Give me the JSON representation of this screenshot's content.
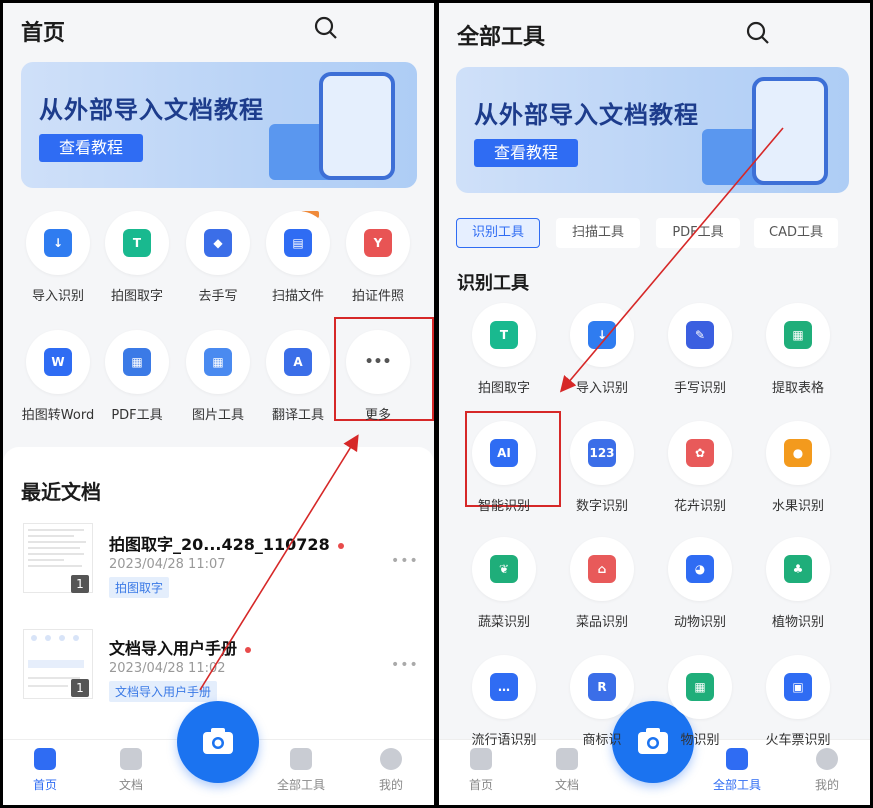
{
  "left": {
    "title": "首页",
    "banner": {
      "text": "从外部导入文档教程",
      "button": "查看教程"
    },
    "tools_row1": [
      {
        "label": "导入识别",
        "icon": "import-icon",
        "color": "#2f7cf0",
        "glyph": "↓"
      },
      {
        "label": "拍图取字",
        "icon": "text-capture-icon",
        "color": "#19b98f",
        "glyph": "T"
      },
      {
        "label": "去手写",
        "icon": "eraser-icon",
        "color": "#3b6ee8",
        "glyph": "◆"
      },
      {
        "label": "扫描文件",
        "icon": "scanner-icon",
        "color": "#2f6cf3",
        "glyph": "▤"
      },
      {
        "label": "拍证件照",
        "icon": "id-photo-icon",
        "color": "#e85454",
        "glyph": "Y"
      }
    ],
    "tools_row2": [
      {
        "label": "拍图转Word",
        "icon": "word-icon",
        "color": "#2f6cf3",
        "glyph": "W"
      },
      {
        "label": "PDF工具",
        "icon": "pdf-tools-icon",
        "color": "#3b7ae6",
        "glyph": "▦"
      },
      {
        "label": "图片工具",
        "icon": "image-tools-icon",
        "color": "#4a8af0",
        "glyph": "▦"
      },
      {
        "label": "翻译工具",
        "icon": "translate-icon",
        "color": "#3b6ee8",
        "glyph": "A"
      },
      {
        "label": "更多",
        "icon": "more-icon",
        "color": "#ffffff",
        "glyph": "•••"
      }
    ],
    "recent_title": "最近文档",
    "docs": [
      {
        "name": "拍图取字_20...428_110728",
        "date": "2023/04/28 11:07",
        "tag": "拍图取字",
        "pages": "1"
      },
      {
        "name": "文档导入用户手册",
        "date": "2023/04/28 11:02",
        "tag": "文档导入用户手册",
        "pages": "1"
      }
    ],
    "tabs": [
      {
        "label": "首页",
        "icon": "home-icon",
        "active": true
      },
      {
        "label": "文档",
        "icon": "document-icon",
        "active": false
      },
      {
        "label": "全部工具",
        "icon": "all-tools-icon",
        "active": false
      },
      {
        "label": "我的",
        "icon": "profile-icon",
        "active": false
      }
    ]
  },
  "right": {
    "title": "全部工具",
    "banner": {
      "text": "从外部导入文档教程",
      "button": "查看教程"
    },
    "chips": [
      {
        "label": "识别工具",
        "active": true
      },
      {
        "label": "扫描工具",
        "active": false
      },
      {
        "label": "PDF工具",
        "active": false
      },
      {
        "label": "CAD工具",
        "active": false
      }
    ],
    "section": "识别工具",
    "grid": [
      {
        "label": "拍图取字",
        "icon": "text-capture-icon",
        "color": "#19b98f",
        "glyph": "T"
      },
      {
        "label": "导入识别",
        "icon": "import-icon",
        "color": "#2f7cf0",
        "glyph": "↓"
      },
      {
        "label": "手写识别",
        "icon": "handwriting-icon",
        "color": "#3b5fe0",
        "glyph": "✎"
      },
      {
        "label": "提取表格",
        "icon": "table-icon",
        "color": "#1fae7a",
        "glyph": "▦"
      },
      {
        "label": "智能识别",
        "icon": "ai-icon",
        "color": "#2f6cf3",
        "glyph": "AI"
      },
      {
        "label": "数字识别",
        "icon": "number-icon",
        "color": "#3b6ee8",
        "glyph": "123"
      },
      {
        "label": "花卉识别",
        "icon": "flower-icon",
        "color": "#e85a5a",
        "glyph": "✿"
      },
      {
        "label": "水果识别",
        "icon": "fruit-icon",
        "color": "#f39a1d",
        "glyph": "●"
      },
      {
        "label": "蔬菜识别",
        "icon": "vegetable-icon",
        "color": "#1fae7a",
        "glyph": "❦"
      },
      {
        "label": "菜品识别",
        "icon": "dish-icon",
        "color": "#e85a5a",
        "glyph": "⌂"
      },
      {
        "label": "动物识别",
        "icon": "animal-icon",
        "color": "#2f6cf3",
        "glyph": "◕"
      },
      {
        "label": "植物识别",
        "icon": "plant-icon",
        "color": "#1fae7a",
        "glyph": "♣"
      },
      {
        "label": "流行语识别",
        "icon": "slang-icon",
        "color": "#2f6cf3",
        "glyph": "…"
      },
      {
        "label": "商标识",
        "icon": "trademark-icon",
        "color": "#3b6ee8",
        "glyph": "R"
      },
      {
        "label": "物识别",
        "icon": "building-icon",
        "color": "#1fae7a",
        "glyph": "▦"
      },
      {
        "label": "火车票识别",
        "icon": "train-ticket-icon",
        "color": "#2f6cf3",
        "glyph": "▣"
      }
    ],
    "tabs": [
      {
        "label": "首页",
        "icon": "home-icon",
        "active": false
      },
      {
        "label": "文档",
        "icon": "document-icon",
        "active": false
      },
      {
        "label": "全部工具",
        "icon": "all-tools-icon",
        "active": true
      },
      {
        "label": "我的",
        "icon": "profile-icon",
        "active": false
      }
    ]
  },
  "annotation_color": "#d62828"
}
